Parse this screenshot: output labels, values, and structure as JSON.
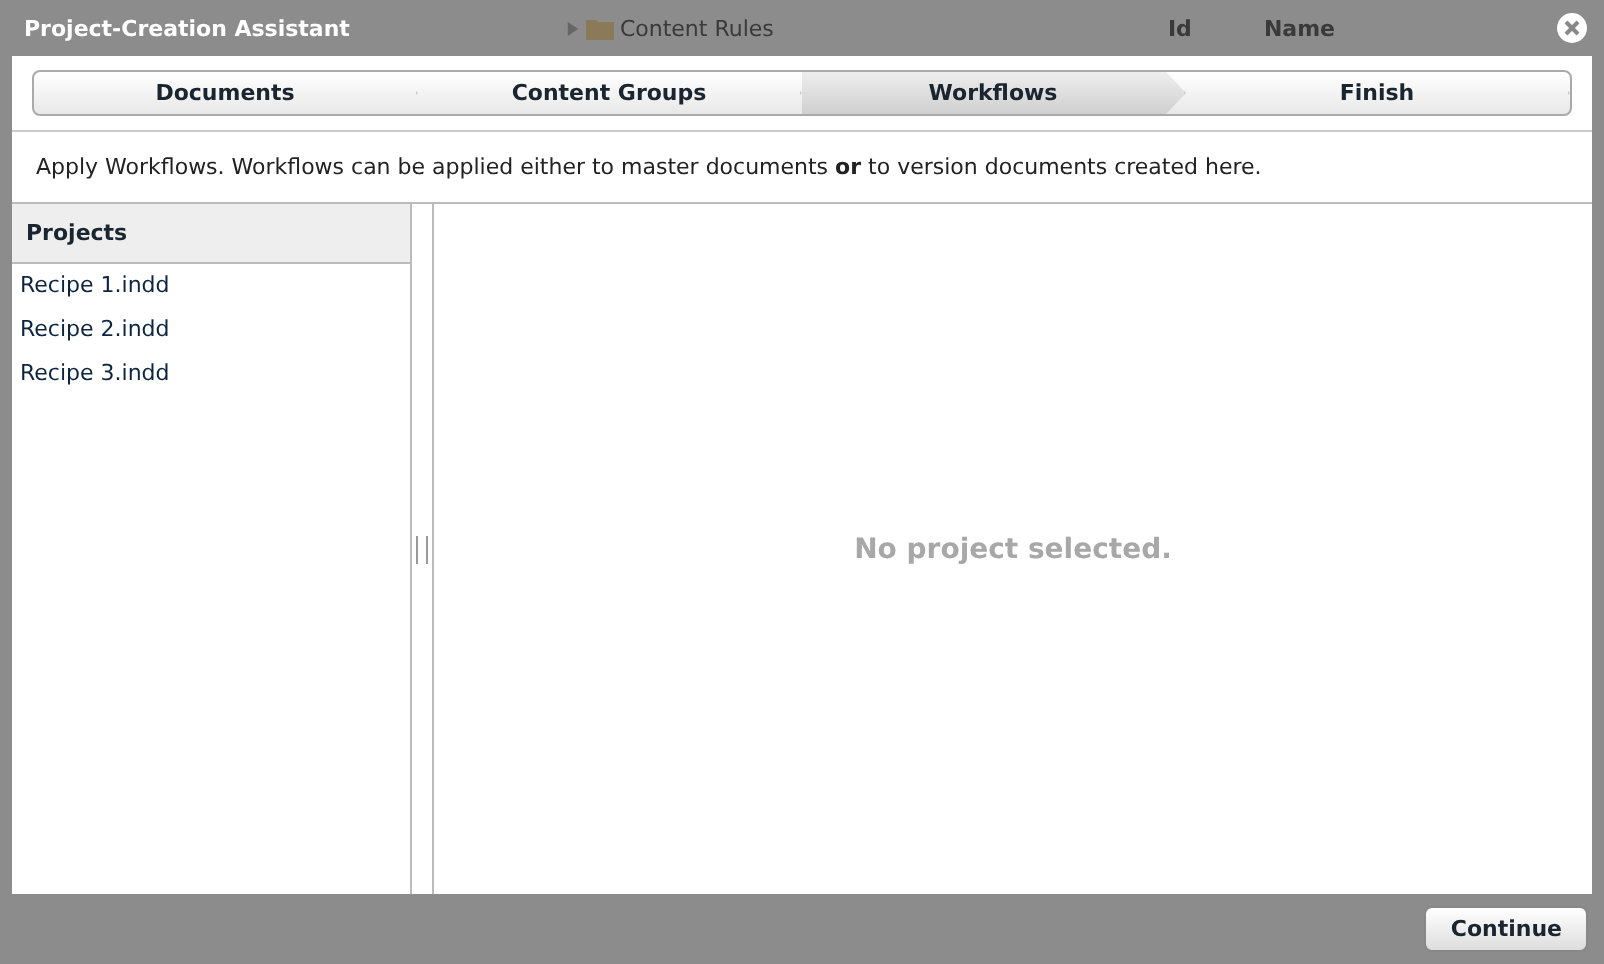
{
  "window": {
    "title": "Project-Creation Assistant"
  },
  "background": {
    "folder": "Content Rules",
    "columns": [
      "Id",
      "Name"
    ]
  },
  "steps": [
    {
      "label": "Documents",
      "selected": false
    },
    {
      "label": "Content Groups",
      "selected": false
    },
    {
      "label": "Workflows",
      "selected": true
    },
    {
      "label": "Finish",
      "selected": false
    }
  ],
  "description": "Apply Workflows. Workflows can be applied either to master documents **or** to version documents created here.",
  "projects": {
    "title": "Projects",
    "items": [
      {
        "label": "Recipe 1.indd"
      },
      {
        "label": "Recipe 2.indd"
      },
      {
        "label": "Recipe 3.indd"
      }
    ]
  },
  "detail": {
    "message": "No project selected."
  },
  "buttons": [
    "Continue"
  ]
}
